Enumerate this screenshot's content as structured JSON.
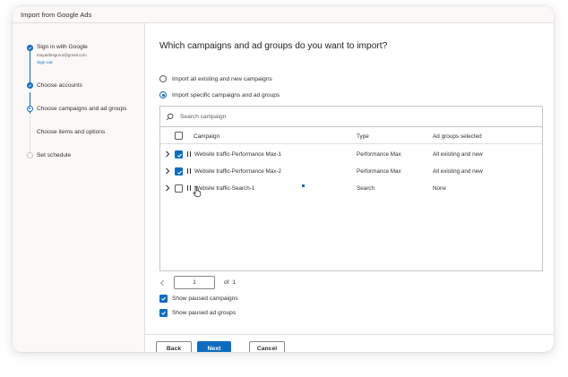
{
  "window": {
    "title": "Import from Google Ads"
  },
  "sidebar": {
    "steps": [
      {
        "label": "Sign in with Google",
        "status": "done"
      },
      {
        "label": "Choose accounts",
        "status": "done"
      },
      {
        "label": "Choose campaigns and ad groups",
        "status": "current"
      },
      {
        "label": "Choose items and options",
        "status": "pending"
      },
      {
        "label": "Set schedule",
        "status": "pending"
      }
    ],
    "account_email": "mayatifesgrout@gmail.com",
    "sign_out": "Sign out"
  },
  "main": {
    "heading": "Which campaigns and ad groups do you want to import?",
    "options": [
      {
        "label": "Import all existing and new campaigns",
        "selected": false
      },
      {
        "label": "Import specific campaigns and ad groups",
        "selected": true
      }
    ],
    "search": {
      "placeholder": "Search campaign"
    },
    "columns": {
      "campaign": "Campaign",
      "type": "Type",
      "ad_groups": "Ad groups selected"
    },
    "rows": [
      {
        "name": "Website traffic-Performance Max-1",
        "type": "Performance Max",
        "ad_groups": "All existing and new",
        "checked": true
      },
      {
        "name": "Website traffic-Performance Max-2",
        "type": "Performance Max",
        "ad_groups": "All existing and new",
        "checked": true
      },
      {
        "name": "Website traffic-Search-1",
        "type": "Search",
        "ad_groups": "None",
        "checked": false
      }
    ],
    "pager": {
      "current": "1",
      "of_label": "of",
      "total": "1"
    },
    "show_paused_campaigns": "Show paused campaigns",
    "show_paused_ad_groups": "Show paused ad groups"
  },
  "footer": {
    "back": "Back",
    "next": "Next",
    "cancel": "Cancel"
  },
  "colors": {
    "accent": "#0f6cbd",
    "border": "#c8c6c4",
    "sidebar_bg": "#faf9f8"
  }
}
